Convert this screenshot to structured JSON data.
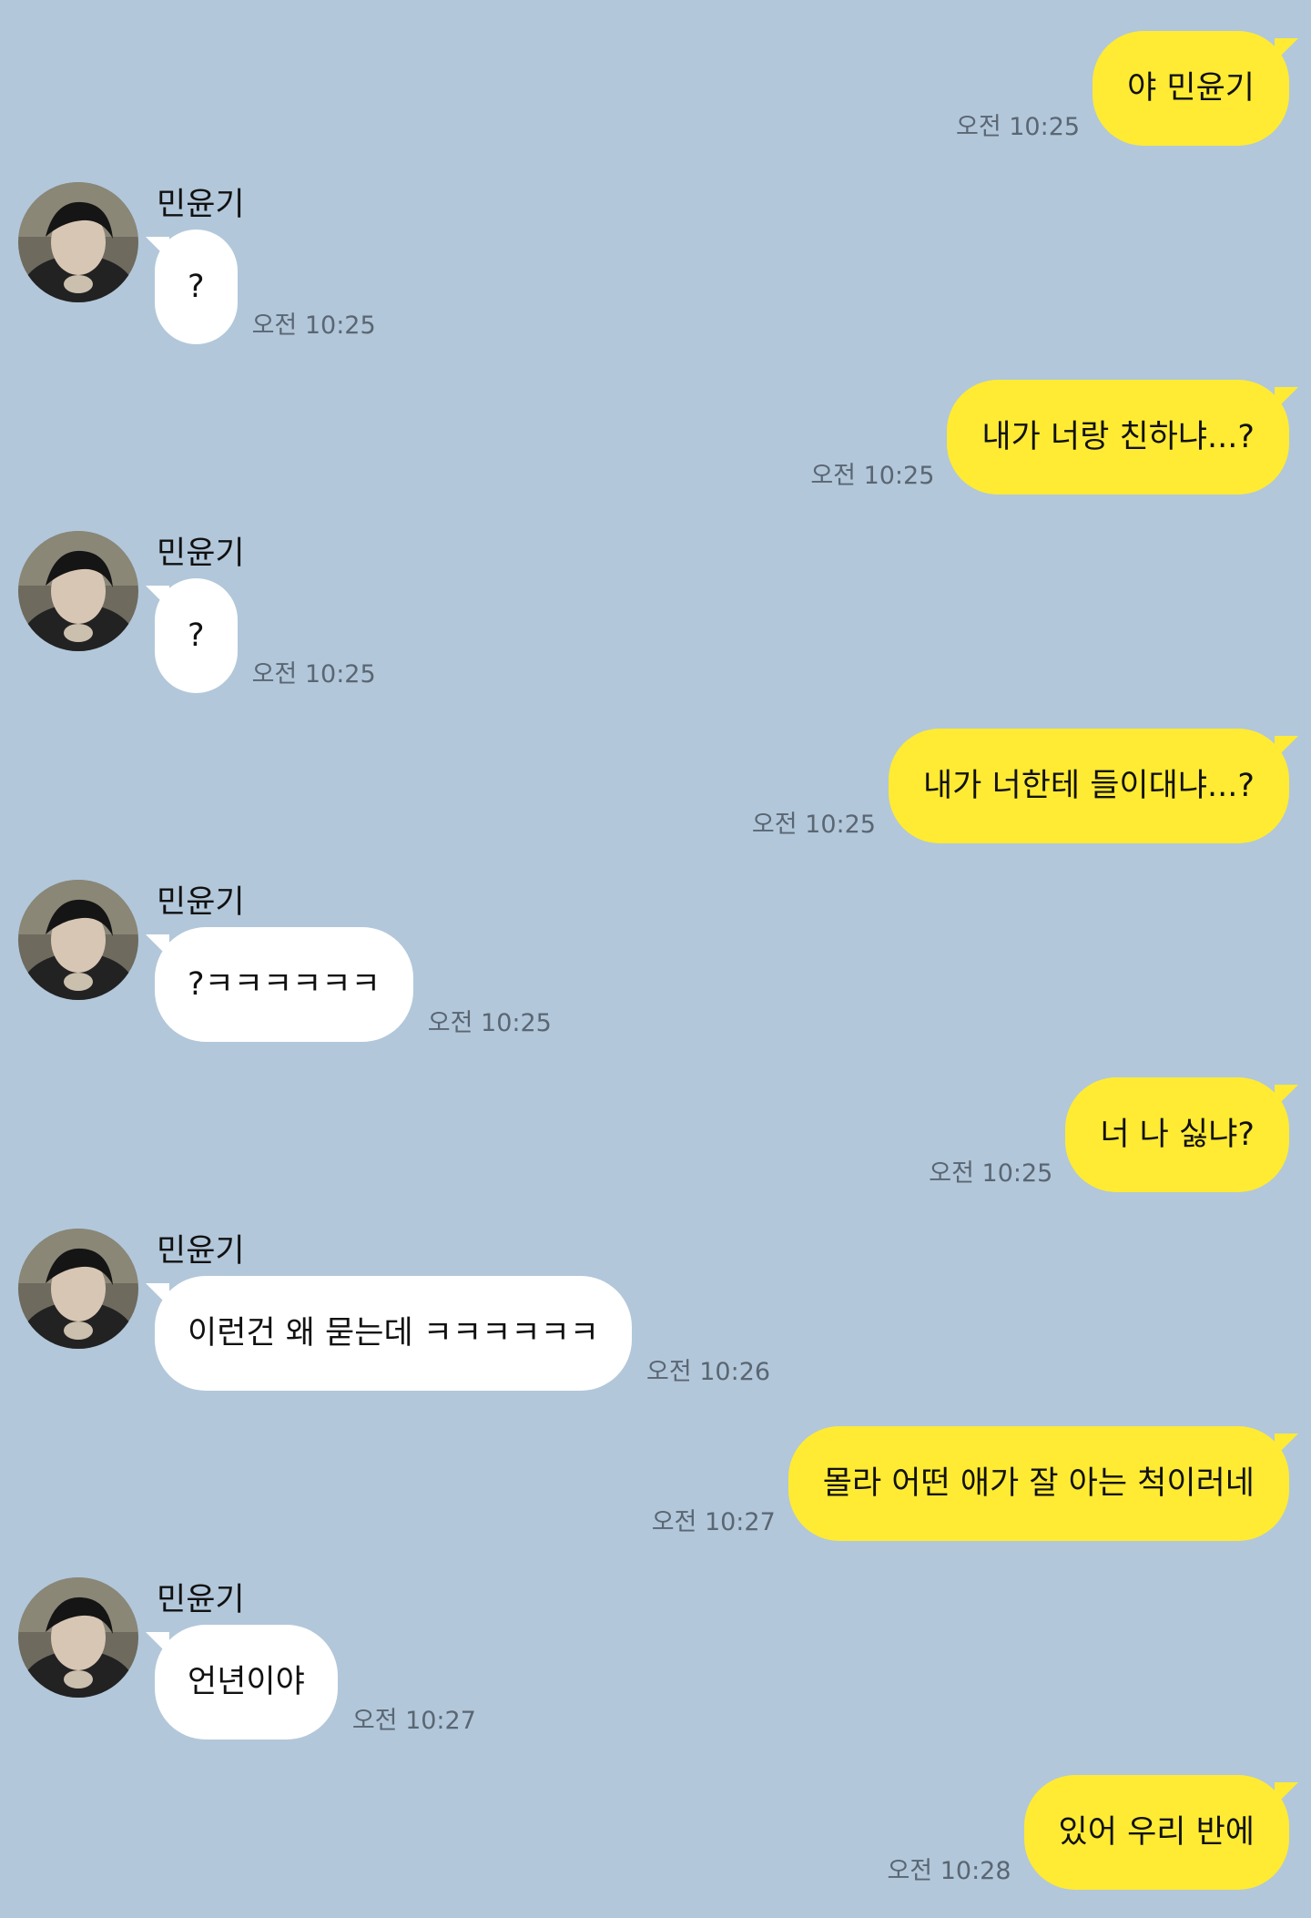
{
  "chat": {
    "colors": {
      "background": "#b2c7da",
      "outgoing_bubble": "#ffeb33",
      "incoming_bubble": "#ffffff",
      "timestamp": "#5a6673"
    },
    "friend_name": "민윤기",
    "messages": [
      {
        "side": "out",
        "text": "야 민윤기",
        "time": "오전 10:25"
      },
      {
        "side": "in",
        "sender": "민윤기",
        "text": "?",
        "time": "오전 10:25"
      },
      {
        "side": "out",
        "text": "내가 너랑 친하냐...?",
        "time": "오전 10:25"
      },
      {
        "side": "in",
        "sender": "민윤기",
        "text": "?",
        "time": "오전 10:25"
      },
      {
        "side": "out",
        "text": "내가 너한테 들이대냐...?",
        "time": "오전 10:25"
      },
      {
        "side": "in",
        "sender": "민윤기",
        "text": "?ㅋㅋㅋㅋㅋㅋ",
        "time": "오전 10:25"
      },
      {
        "side": "out",
        "text": "너 나 싫냐?",
        "time": "오전 10:25"
      },
      {
        "side": "in",
        "sender": "민윤기",
        "text": "이런건 왜 묻는데 ㅋㅋㅋㅋㅋㅋ",
        "time": "오전 10:26"
      },
      {
        "side": "out",
        "text": "몰라 어떤 애가 잘 아는 척이러네",
        "time": "오전 10:27"
      },
      {
        "side": "in",
        "sender": "민윤기",
        "text": "언년이야",
        "time": "오전 10:27"
      },
      {
        "side": "out",
        "text": "있어 우리 반에",
        "time": "오전 10:28"
      }
    ]
  }
}
